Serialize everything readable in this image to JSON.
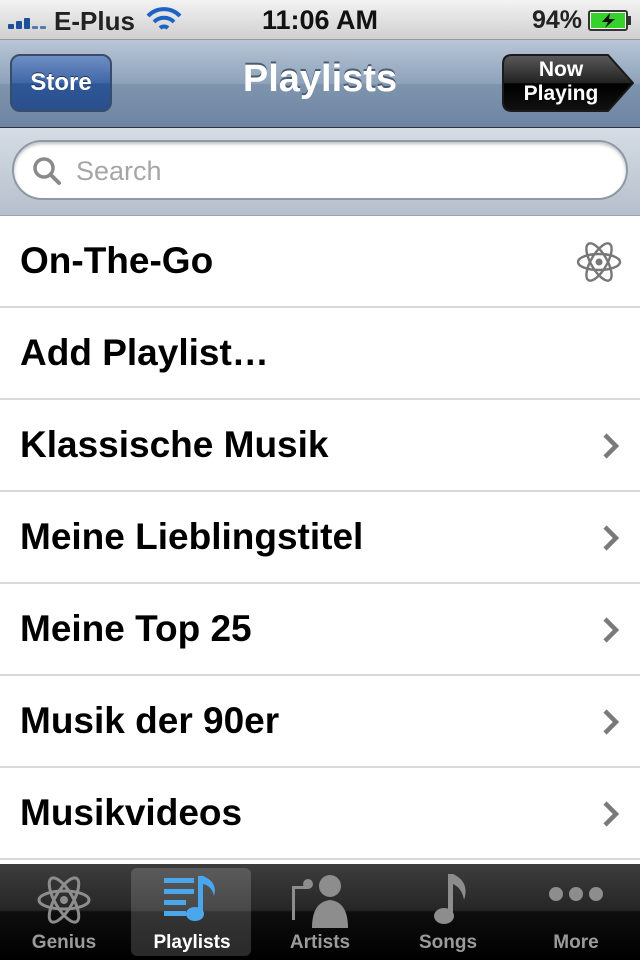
{
  "status_bar": {
    "carrier": "E-Plus",
    "time": "11:06 AM",
    "battery_percent": "94%"
  },
  "nav_bar": {
    "left_button": "Store",
    "title": "Playlists",
    "right_button_line1": "Now",
    "right_button_line2": "Playing"
  },
  "search": {
    "placeholder": "Search",
    "value": ""
  },
  "playlists": [
    {
      "label": "On-The-Go",
      "accessory": "genius-atom-icon"
    },
    {
      "label": "Add Playlist…",
      "accessory": "none"
    },
    {
      "label": "Klassische Musik",
      "accessory": "chevron-right-icon"
    },
    {
      "label": "Meine Lieblingstitel",
      "accessory": "chevron-right-icon"
    },
    {
      "label": "Meine Top 25",
      "accessory": "chevron-right-icon"
    },
    {
      "label": "Musik der 90er",
      "accessory": "chevron-right-icon"
    },
    {
      "label": "Musikvideos",
      "accessory": "chevron-right-icon"
    }
  ],
  "tab_bar": {
    "selected": "Playlists",
    "tabs": [
      {
        "label": "Genius",
        "icon": "genius-atom-icon"
      },
      {
        "label": "Playlists",
        "icon": "playlists-icon"
      },
      {
        "label": "Artists",
        "icon": "artist-singer-icon"
      },
      {
        "label": "Songs",
        "icon": "music-note-icon"
      },
      {
        "label": "More",
        "icon": "more-dots-icon"
      }
    ]
  },
  "colors": {
    "nav_blue": "#6d85a3",
    "store_button": "#2f5797",
    "selected_tab_icon": "#4aa7ec",
    "battery_fill": "#37d12c"
  }
}
